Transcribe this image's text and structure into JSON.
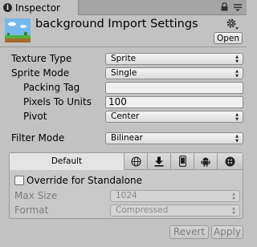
{
  "window": {
    "tab_label": "Inspector"
  },
  "header": {
    "title": "background Import Settings",
    "open_label": "Open"
  },
  "properties": {
    "texture_type": {
      "label": "Texture Type",
      "value": "Sprite"
    },
    "sprite_mode": {
      "label": "Sprite Mode",
      "value": "Single"
    },
    "packing_tag": {
      "label": "Packing Tag",
      "value": ""
    },
    "pixels_to_units": {
      "label": "Pixels To Units",
      "value": "100"
    },
    "pivot": {
      "label": "Pivot",
      "value": "Center"
    },
    "filter_mode": {
      "label": "Filter Mode",
      "value": "Bilinear"
    }
  },
  "platforms": {
    "tabs": [
      {
        "label": "Default",
        "icon": ""
      },
      {
        "label": "",
        "icon": "globe-icon"
      },
      {
        "label": "",
        "icon": "download-icon"
      },
      {
        "label": "",
        "icon": "phone-icon"
      },
      {
        "label": "",
        "icon": "android-icon"
      },
      {
        "label": "",
        "icon": "blackberry-icon"
      }
    ],
    "active_tab": 0,
    "override_label": "Override for Standalone",
    "override_checked": false,
    "max_size": {
      "label": "Max Size",
      "value": "1024"
    },
    "format": {
      "label": "Format",
      "value": "Compressed"
    }
  },
  "buttons": {
    "revert": "Revert",
    "apply": "Apply"
  }
}
